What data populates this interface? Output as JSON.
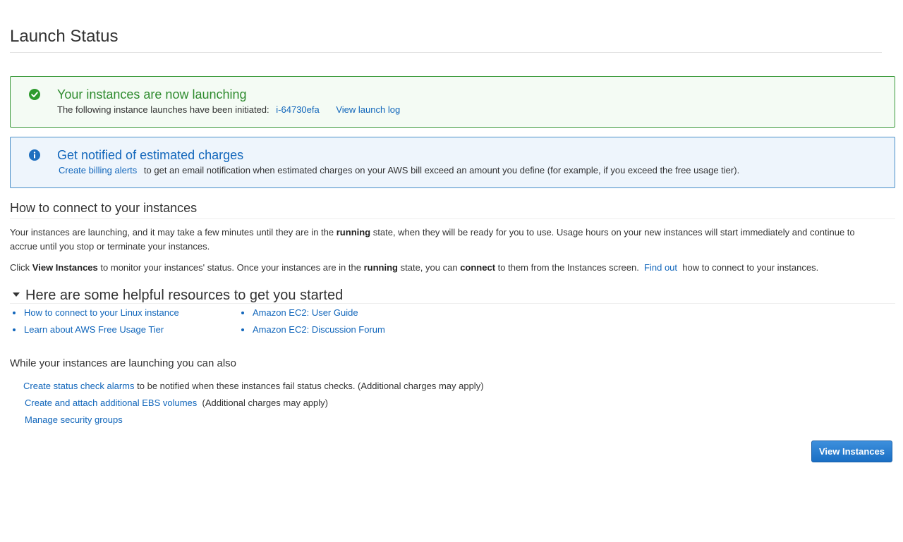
{
  "page": {
    "title": "Launch Status"
  },
  "success_alert": {
    "icon": "check-circle-icon",
    "color": "#2e8b2e",
    "heading": "Your instances are now launching",
    "body_prefix": "The following instance launches have been initiated:",
    "instance_id": "i-64730efa",
    "view_log_link": "View launch log"
  },
  "info_alert": {
    "icon": "info-circle-icon",
    "color": "#1166bb",
    "heading": "Get notified of estimated charges",
    "billing_link": "Create billing alerts",
    "body_suffix": "to get an email notification when estimated charges on your AWS bill exceed an amount you define (for example, if you exceed the free usage tier)."
  },
  "connect": {
    "heading": "How to connect to your instances",
    "para1": {
      "a": "Your instances are launching, and it may take a few minutes until they are in the",
      "b_bold": "running",
      "c": "state, when they will be ready for you to use. Usage hours on your new instances will start immediately and continue to accrue until you stop or terminate your instances."
    },
    "para2": {
      "a": "Click",
      "b_bold": "View Instances",
      "c": "to monitor your instances' status. Once your instances are in the",
      "d_bold": "running",
      "e": "state, you can",
      "f_bold": "connect",
      "g": "to them from the Instances screen.",
      "find_out_link": "Find out",
      "h": "how to connect to your instances."
    }
  },
  "resources": {
    "heading": "Here are some helpful resources to get you started",
    "col1": [
      "How to connect to your Linux instance",
      "Learn about AWS Free Usage Tier"
    ],
    "col2": [
      "Amazon EC2: User Guide",
      "Amazon EC2: Discussion Forum"
    ]
  },
  "also": {
    "heading": "While your instances are launching you can also",
    "row1_link": "Create status check alarms",
    "row1_text": "to be notified when these instances fail status checks. (Additional charges may apply)",
    "row2_link": "Create and attach additional EBS volumes",
    "row2_text": "(Additional charges may apply)",
    "row3_link": "Manage security groups"
  },
  "actions": {
    "view_instances_button": "View Instances"
  }
}
